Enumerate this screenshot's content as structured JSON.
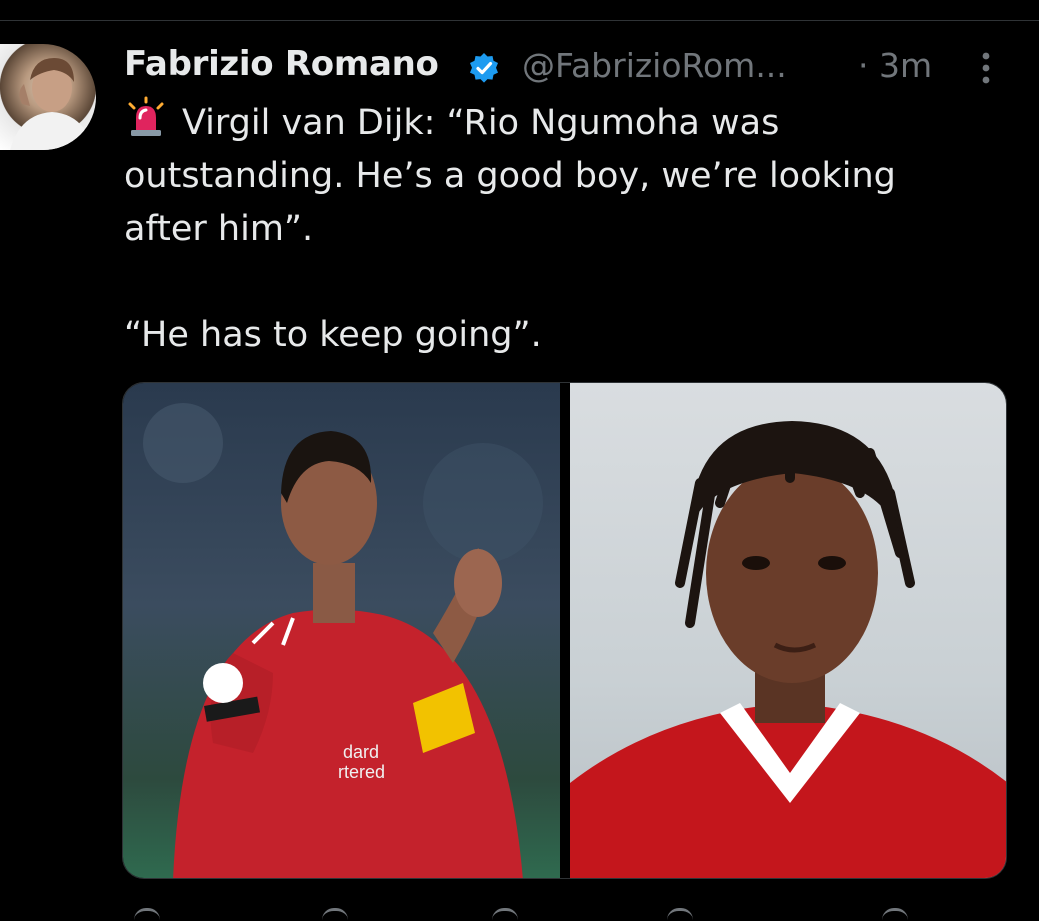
{
  "tweet": {
    "author_name": "Fabrizio Romano",
    "author_handle": "@FabrizioRom...",
    "timestamp": "· 3m",
    "text_line1": "Virgil van Dijk: “Rio Ngumoha was",
    "text_rest": "outstanding. He’s a good boy, we’re looking\nafter him”.\n\n“He has to keep going”.",
    "media": [
      {
        "label": "photo-virgil-van-dijk"
      },
      {
        "label": "photo-rio-ngumoha"
      }
    ]
  },
  "colors": {
    "background": "#000000",
    "text": "#e7e9ea",
    "secondary_text": "#71767b",
    "verified": "#1d9bf0",
    "siren": "#e0245e"
  },
  "icons": [
    "verified-badge-icon",
    "more-options-icon",
    "siren-emoji-icon"
  ]
}
